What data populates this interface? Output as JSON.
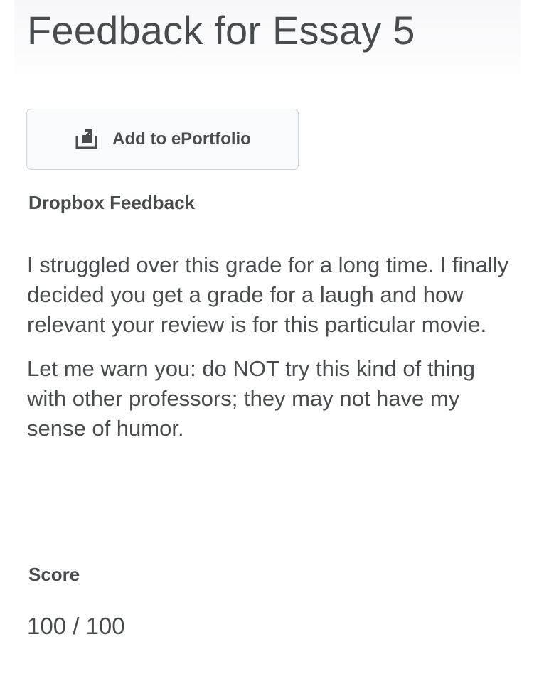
{
  "page": {
    "title": "Feedback for Essay 5"
  },
  "actions": {
    "eportfolio_label": "Add to ePortfolio",
    "eportfolio_icon": "add-to-portfolio-icon"
  },
  "feedback": {
    "heading": "Dropbox Feedback",
    "paragraphs": [
      "I struggled over this grade for a long time.  I finally decided you get a grade for a laugh and how relevant your review is for this particular movie.",
      "Let me warn you:  do NOT try this kind of thing with other professors; they may not have my sense of humor."
    ]
  },
  "score": {
    "heading": "Score",
    "value": "100 / 100"
  },
  "colors": {
    "text": "#494c4e",
    "button_border": "#cdd5dc",
    "button_background": "#f9fafb"
  }
}
